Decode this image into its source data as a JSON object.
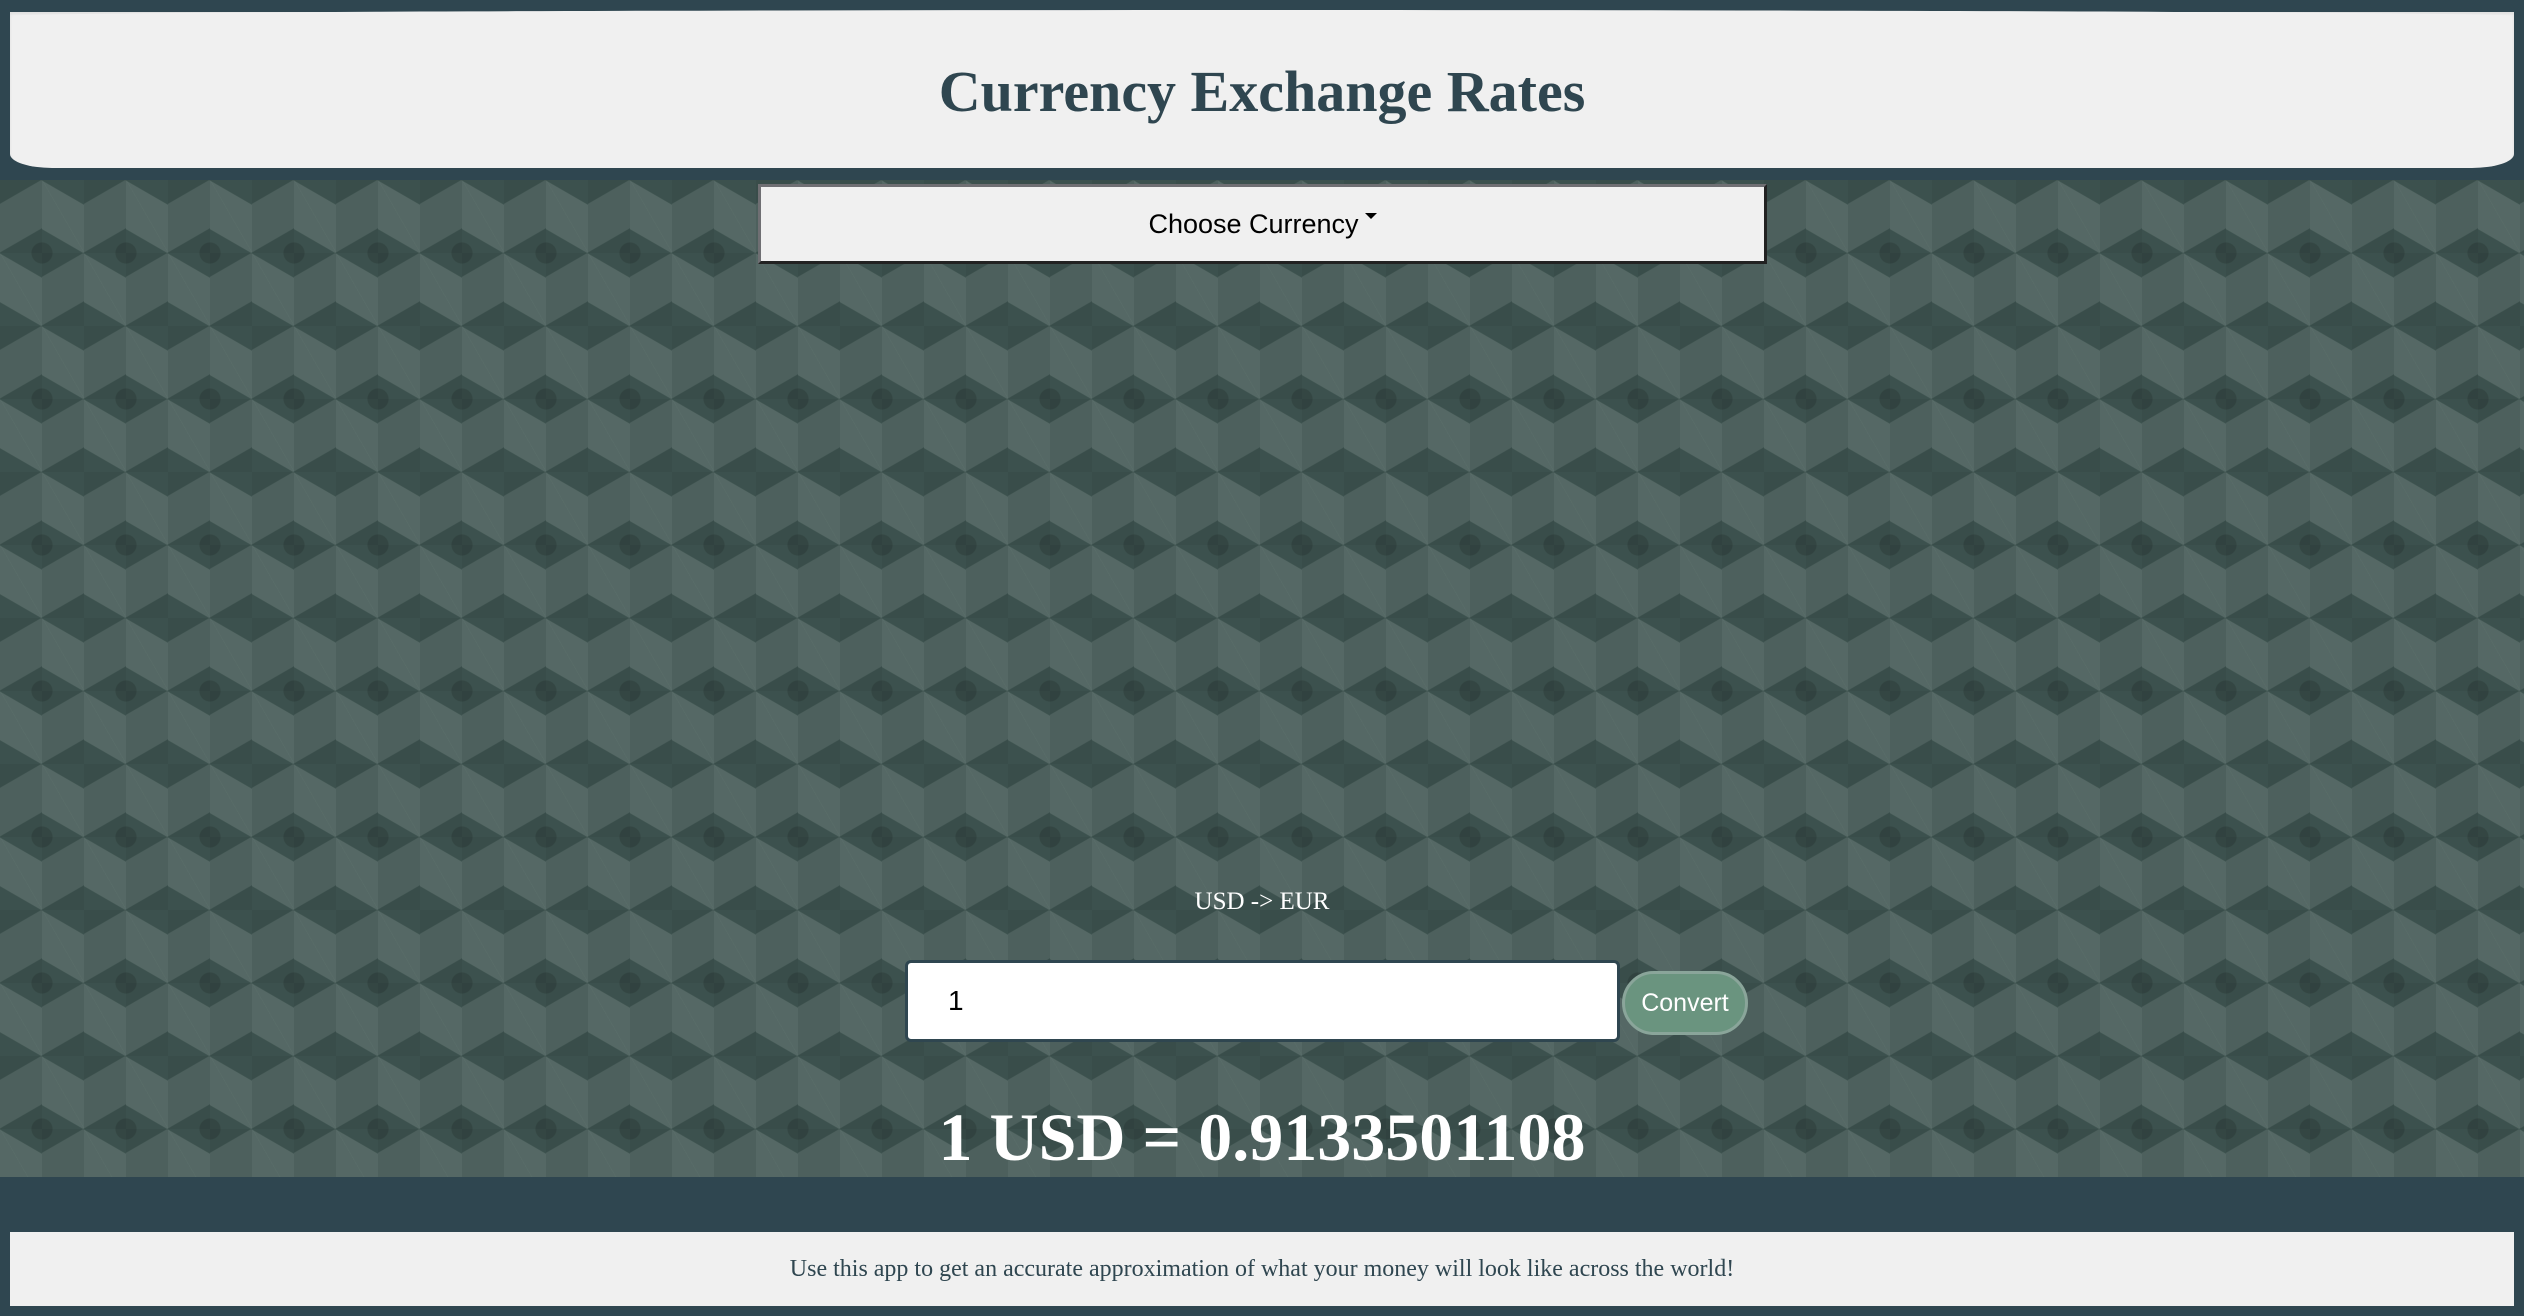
{
  "header": {
    "title": "Currency Exchange Rates"
  },
  "dropdown": {
    "label": "Choose Currency"
  },
  "conversion": {
    "pair_label": "USD -> EUR",
    "amount_value": "1",
    "convert_label": "Convert",
    "result_text": "1 USD = 0.9133501108"
  },
  "footer": {
    "text": "Use this app to get an accurate approximation of what your money will look like across the world!"
  },
  "colors": {
    "primary_dark": "#2f4650",
    "panel_light": "#f0f0f0",
    "convert_green": "#6a947f"
  }
}
